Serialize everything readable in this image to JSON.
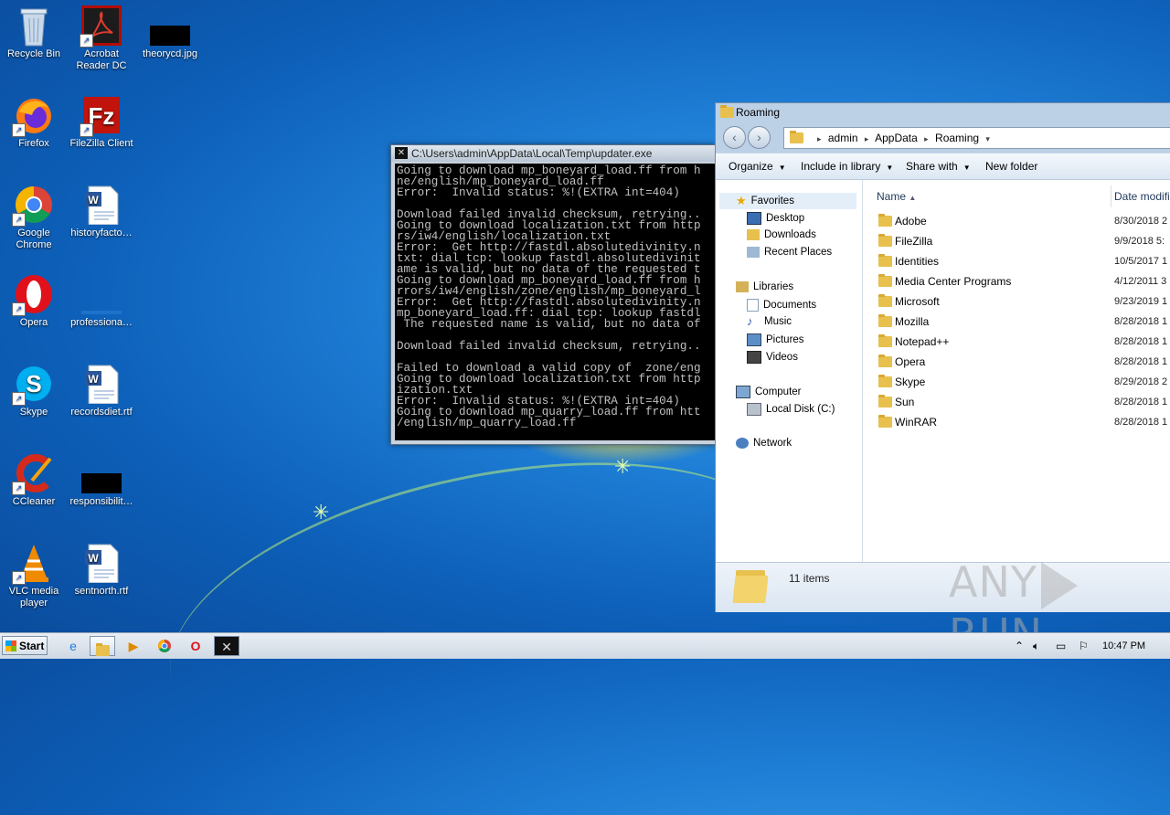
{
  "desktop": {
    "icons": [
      {
        "label": "Recycle Bin",
        "icon": "recycle-bin-icon"
      },
      {
        "label": "Acrobat Reader DC",
        "icon": "acrobat-icon"
      },
      {
        "label": "theorycd.jpg",
        "icon": "image-file-icon"
      },
      {
        "label": "Firefox",
        "icon": "firefox-icon"
      },
      {
        "label": "FileZilla Client",
        "icon": "filezilla-icon"
      },
      {
        "label": "Google Chrome",
        "icon": "chrome-icon"
      },
      {
        "label": "historyfacto…",
        "icon": "word-doc-icon"
      },
      {
        "label": "Opera",
        "icon": "opera-icon"
      },
      {
        "label": "professiona…",
        "icon": "file-icon"
      },
      {
        "label": "Skype",
        "icon": "skype-icon"
      },
      {
        "label": "recordsdiet.rtf",
        "icon": "word-doc-icon"
      },
      {
        "label": "CCleaner",
        "icon": "ccleaner-icon"
      },
      {
        "label": "responsibilit…",
        "icon": "image-file-icon"
      },
      {
        "label": "VLC media player",
        "icon": "vlc-icon"
      },
      {
        "label": "sentnorth.rtf",
        "icon": "word-doc-icon"
      }
    ]
  },
  "console": {
    "title": "C:\\Users\\admin\\AppData\\Local\\Temp\\updater.exe",
    "lines": [
      "Going to download mp_boneyard_load.ff from h",
      "ne/english/mp_boneyard_load.ff",
      "Error:  Invalid status: %!(EXTRA int=404)",
      "",
      "Download failed invalid checksum, retrying..",
      "Going to download localization.txt from http",
      "rs/iw4/english/localization.txt",
      "Error:  Get http://fastdl.absolutedivinity.n",
      "txt: dial tcp: lookup fastdl.absolutedivinit",
      "ame is valid, but no data of the requested t",
      "Going to download mp_boneyard_load.ff from h",
      "rrors/iw4/english/zone/english/mp_boneyard_l",
      "Error:  Get http://fastdl.absolutedivinity.n",
      "mp_boneyard_load.ff: dial tcp: lookup fastdl",
      " The requested name is valid, but no data of",
      "",
      "Download failed invalid checksum, retrying..",
      "",
      "Failed to download a valid copy of  zone/eng",
      "Going to download localization.txt from http",
      "ization.txt",
      "Error:  Invalid status: %!(EXTRA int=404)",
      "Going to download mp_quarry_load.ff from htt",
      "/english/mp_quarry_load.ff"
    ]
  },
  "explorer": {
    "title": "Roaming",
    "breadcrumb": [
      "admin",
      "AppData",
      "Roaming"
    ],
    "toolbar": {
      "organize": "Organize",
      "include": "Include in library",
      "share": "Share with",
      "new_folder": "New folder"
    },
    "nav": {
      "favorites": "Favorites",
      "desktop": "Desktop",
      "downloads": "Downloads",
      "recent": "Recent Places",
      "libraries": "Libraries",
      "documents": "Documents",
      "music": "Music",
      "pictures": "Pictures",
      "videos": "Videos",
      "computer": "Computer",
      "local_disk": "Local Disk (C:)",
      "network": "Network"
    },
    "columns": {
      "name": "Name",
      "date": "Date modifie"
    },
    "files": [
      {
        "name": "Adobe",
        "date": "8/30/2018 2"
      },
      {
        "name": "FileZilla",
        "date": "9/9/2018 5:"
      },
      {
        "name": "Identities",
        "date": "10/5/2017 1"
      },
      {
        "name": "Media Center Programs",
        "date": "4/12/2011 3"
      },
      {
        "name": "Microsoft",
        "date": "9/23/2019 1"
      },
      {
        "name": "Mozilla",
        "date": "8/28/2018 1"
      },
      {
        "name": "Notepad++",
        "date": "8/28/2018 1"
      },
      {
        "name": "Opera",
        "date": "8/28/2018 1"
      },
      {
        "name": "Skype",
        "date": "8/29/2018 2"
      },
      {
        "name": "Sun",
        "date": "8/28/2018 1"
      },
      {
        "name": "WinRAR",
        "date": "8/28/2018 1"
      }
    ],
    "item_count": "11 items"
  },
  "watermark": {
    "left": "ANY",
    "right": "RUN"
  },
  "taskbar": {
    "start": "Start",
    "clock": "10:47 PM"
  }
}
